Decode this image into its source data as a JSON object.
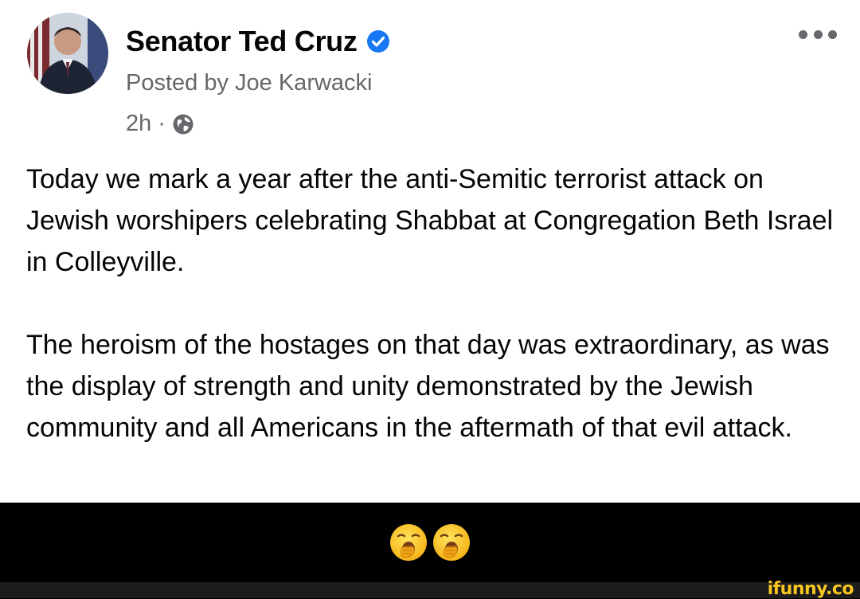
{
  "post": {
    "author_name": "Senator Ted Cruz",
    "verified": true,
    "posted_by": "Posted by Joe Karwacki",
    "time": "2h",
    "separator": "·",
    "privacy_icon": "globe-icon",
    "paragraphs": [
      "Today we mark a year after the anti-Semitic terrorist attack on Jewish worshipers celebrating Shabbat at Congregation Beth Israel in Colleyville.",
      "The heroism of the hostages on that day was extraordinary, as was the display of strength and unity demonstrated by the Jewish community and all Americans in the aftermath of that evil attack."
    ],
    "more_icon": "more-options-icon"
  },
  "caption": {
    "emojis": [
      "yawning-face-emoji",
      "yawning-face-emoji"
    ]
  },
  "watermark": "ifunny.co",
  "colors": {
    "verified_blue": "#1877f2",
    "meta_gray": "#65676b",
    "text": "#050505",
    "watermark_yellow": "#f7c51e"
  }
}
